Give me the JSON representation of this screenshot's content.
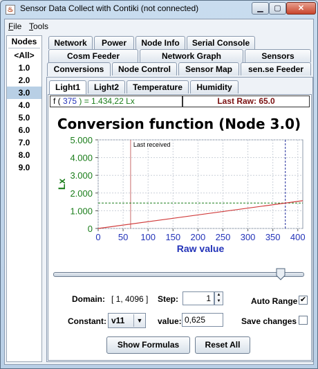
{
  "window": {
    "title": "Sensor Data Collect with Contiki (not connected)",
    "icon_glyph": "♨",
    "min_glyph": "▁",
    "max_glyph": "▢",
    "close_glyph": "✕"
  },
  "menu": {
    "file": {
      "mnemonic": "F",
      "rest": "ile"
    },
    "tools": {
      "mnemonic": "T",
      "rest": "ools"
    }
  },
  "nodes": {
    "title": "Nodes",
    "items": [
      "<All>",
      "1.0",
      "2.0",
      "3.0",
      "4.0",
      "5.0",
      "6.0",
      "7.0",
      "8.0",
      "9.0"
    ],
    "selected": "3.0"
  },
  "tabs": {
    "row1": [
      "Network",
      "Power",
      "Node Info",
      "Serial Console"
    ],
    "row2": [
      "Cosm Feeder",
      "Network Graph",
      "Sensors"
    ],
    "row3": [
      "Conversions",
      "Node Control",
      "Sensor Map",
      "sen.se Feeder"
    ],
    "active": "Conversions"
  },
  "subtabs": {
    "items": [
      "Light1",
      "Light2",
      "Temperature",
      "Humidity"
    ],
    "active": "Light1"
  },
  "formula": {
    "prefix": "f ( ",
    "raw": "375",
    "suffix": " ) = 1.434,22 Lx",
    "last_raw": "Last Raw: 65.0"
  },
  "chart_data": {
    "type": "line",
    "title": "Conversion function (Node 3.0)",
    "xlabel": "Raw value",
    "ylabel": "Lx",
    "xlim": [
      0,
      410
    ],
    "ylim": [
      0,
      5000
    ],
    "x_ticks": [
      0,
      50,
      100,
      150,
      200,
      250,
      300,
      350,
      400
    ],
    "y_ticks": [
      "0",
      "1.000",
      "2.000",
      "3.000",
      "4.000",
      "5.000"
    ],
    "y_tick_values": [
      0,
      1000,
      2000,
      3000,
      4000,
      5000
    ],
    "series": [
      {
        "x": [
          0,
          410
        ],
        "y": [
          0,
          1568
        ],
        "color": "#d03a3a"
      }
    ],
    "markers": {
      "last_received_x": 65,
      "last_received_label": "Last received",
      "selected_x": 375,
      "selected_y": 1434.22
    },
    "colors": {
      "x_axis": "#2232b8",
      "y_axis": "#1a7d1a",
      "grid": "#c9cfd8"
    },
    "grid": true
  },
  "slider": {
    "value": 375,
    "min": 0,
    "max": 410
  },
  "form": {
    "domain_label": "Domain:",
    "domain_value": "[ 1, 4096 ]",
    "step_label": "Step:",
    "step_value": "1",
    "auto_range_label": "Auto Range",
    "auto_range_checked": "✔",
    "constant_label": "Constant:",
    "constant_value": "v11",
    "constant_arrow": "▼",
    "value_label": "value:",
    "value_value": "0,625",
    "save_changes_label": "Save changes",
    "save_changes_checked": ""
  },
  "buttons": {
    "show_formulas": "Show Formulas",
    "reset_all": "Reset All"
  }
}
